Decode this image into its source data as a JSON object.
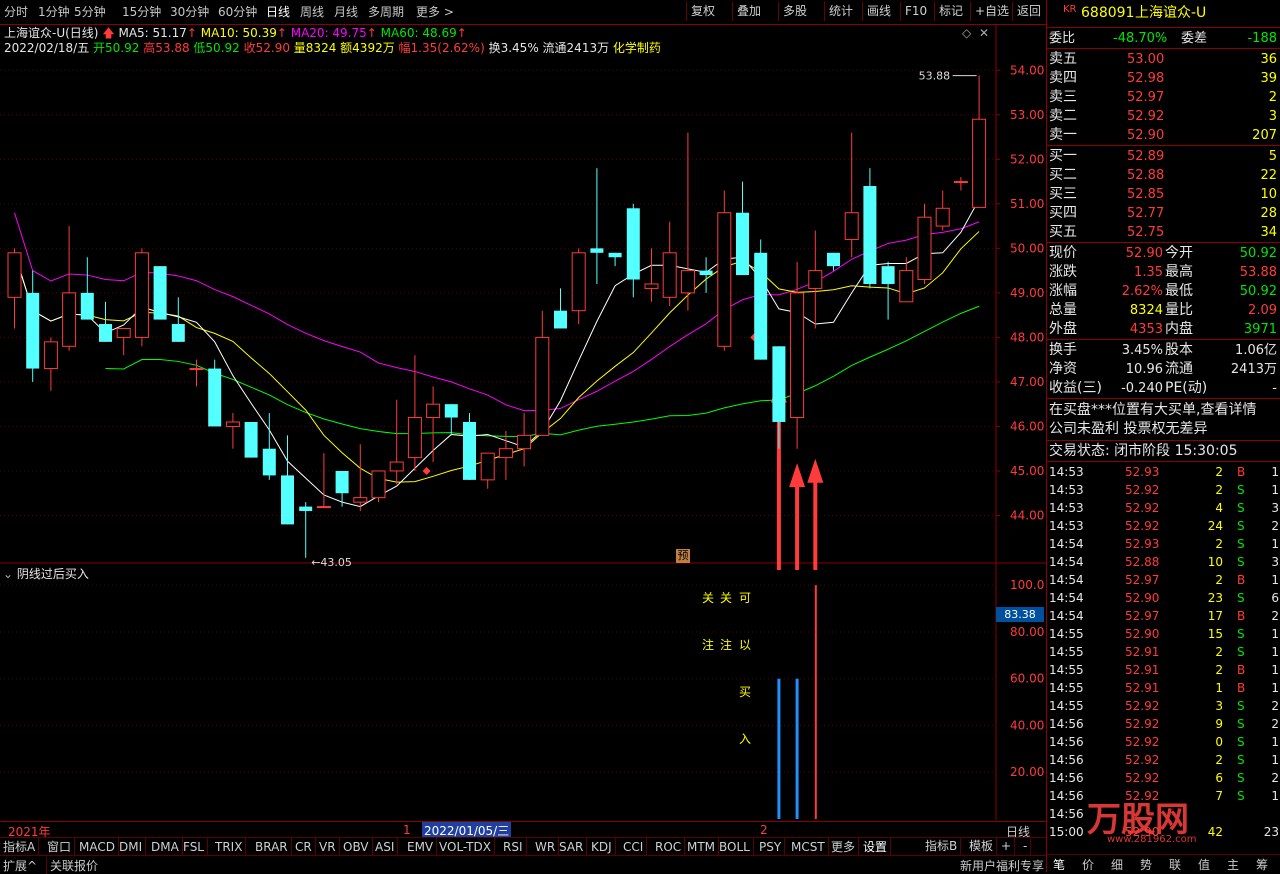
{
  "toolbar": {
    "periods": [
      "分时",
      "1分钟",
      "5分钟",
      "15分钟",
      "30分钟",
      "60分钟",
      "日线",
      "周线",
      "月线",
      "多周期",
      "更多"
    ],
    "active_period": "日线",
    "tools": [
      "复权",
      "叠加",
      "多股",
      "统计",
      "画线",
      "F10",
      "标记",
      "+自选",
      "返回"
    ]
  },
  "stock": {
    "title_line": "上海谊众-U(日线)",
    "ma5": "MA5: 51.17",
    "ma10": "MA10: 50.39",
    "ma20": "MA20: 49.75",
    "ma60": "MA60: 48.69",
    "date": "2022/02/18/五",
    "open": "开50.92",
    "high": "高53.88",
    "low": "低50.92",
    "close": "收52.90",
    "volume": "量8324",
    "amount": "额4392万",
    "change": "幅1.35(2.62%)",
    "turnover": "换3.45%",
    "float": "流通2413万",
    "sector": "化学制药"
  },
  "chart_data": {
    "type": "candlestick",
    "title": "上海谊众-U(日线)",
    "ylim": [
      43.0,
      54.5
    ],
    "yticks": [
      "54.00",
      "53.00",
      "52.00",
      "51.00",
      "50.00",
      "49.00",
      "48.00",
      "47.00",
      "46.00",
      "45.00",
      "44.00"
    ],
    "annotations": [
      "53.88",
      "43.05"
    ],
    "candles": [
      {
        "o": 48.9,
        "h": 50.0,
        "l": 48.2,
        "c": 49.9
      },
      {
        "o": 49.0,
        "h": 49.5,
        "l": 47.0,
        "c": 47.3
      },
      {
        "o": 47.3,
        "h": 48.0,
        "l": 46.8,
        "c": 47.9
      },
      {
        "o": 47.8,
        "h": 50.5,
        "l": 47.7,
        "c": 49.0
      },
      {
        "o": 49.0,
        "h": 49.8,
        "l": 48.4,
        "c": 48.4
      },
      {
        "o": 48.3,
        "h": 48.8,
        "l": 47.9,
        "c": 47.9
      },
      {
        "o": 48.0,
        "h": 48.2,
        "l": 47.6,
        "c": 48.2
      },
      {
        "o": 48.0,
        "h": 50.0,
        "l": 47.8,
        "c": 49.9
      },
      {
        "o": 49.6,
        "h": 49.6,
        "l": 48.4,
        "c": 48.4
      },
      {
        "o": 48.3,
        "h": 48.9,
        "l": 47.9,
        "c": 47.9
      },
      {
        "o": 47.3,
        "h": 47.5,
        "l": 46.9,
        "c": 47.3
      },
      {
        "o": 47.3,
        "h": 47.5,
        "l": 46.0,
        "c": 46.0
      },
      {
        "o": 46.0,
        "h": 46.3,
        "l": 45.5,
        "c": 46.1
      },
      {
        "o": 46.1,
        "h": 46.1,
        "l": 45.3,
        "c": 45.3
      },
      {
        "o": 45.5,
        "h": 46.3,
        "l": 44.8,
        "c": 44.9
      },
      {
        "o": 44.9,
        "h": 45.8,
        "l": 43.8,
        "c": 43.8
      },
      {
        "o": 44.2,
        "h": 44.3,
        "l": 43.05,
        "c": 44.1
      },
      {
        "o": 44.2,
        "h": 45.4,
        "l": 44.2,
        "c": 44.2
      },
      {
        "o": 45.0,
        "h": 45.0,
        "l": 44.2,
        "c": 44.5
      },
      {
        "o": 44.3,
        "h": 45.6,
        "l": 44.1,
        "c": 44.4
      },
      {
        "o": 44.4,
        "h": 45.0,
        "l": 44.3,
        "c": 45.0
      },
      {
        "o": 45.0,
        "h": 46.6,
        "l": 44.7,
        "c": 45.2
      },
      {
        "o": 45.3,
        "h": 47.6,
        "l": 45.0,
        "c": 46.2
      },
      {
        "o": 46.2,
        "h": 46.9,
        "l": 45.2,
        "c": 46.5
      },
      {
        "o": 46.5,
        "h": 46.5,
        "l": 45.8,
        "c": 46.2
      },
      {
        "o": 46.1,
        "h": 46.3,
        "l": 44.8,
        "c": 44.8
      },
      {
        "o": 44.8,
        "h": 45.4,
        "l": 44.6,
        "c": 45.4
      },
      {
        "o": 45.3,
        "h": 45.9,
        "l": 44.8,
        "c": 45.5
      },
      {
        "o": 45.5,
        "h": 46.3,
        "l": 45.1,
        "c": 45.8
      },
      {
        "o": 45.8,
        "h": 48.6,
        "l": 45.8,
        "c": 48.0
      },
      {
        "o": 48.6,
        "h": 49.1,
        "l": 48.2,
        "c": 48.2
      },
      {
        "o": 48.6,
        "h": 50.0,
        "l": 48.3,
        "c": 49.9
      },
      {
        "o": 50.0,
        "h": 51.8,
        "l": 49.2,
        "c": 49.9
      },
      {
        "o": 49.9,
        "h": 49.9,
        "l": 49.6,
        "c": 49.8
      },
      {
        "o": 50.9,
        "h": 51.0,
        "l": 48.9,
        "c": 49.3
      },
      {
        "o": 49.1,
        "h": 50.0,
        "l": 48.8,
        "c": 49.2
      },
      {
        "o": 48.9,
        "h": 50.6,
        "l": 48.7,
        "c": 49.9
      },
      {
        "o": 49.0,
        "h": 52.6,
        "l": 48.6,
        "c": 49.5
      },
      {
        "o": 49.5,
        "h": 49.8,
        "l": 49.0,
        "c": 49.4
      },
      {
        "o": 47.8,
        "h": 51.3,
        "l": 47.7,
        "c": 50.8
      },
      {
        "o": 50.8,
        "h": 51.5,
        "l": 49.4,
        "c": 49.4
      },
      {
        "o": 49.9,
        "h": 50.2,
        "l": 47.5,
        "c": 47.5
      },
      {
        "o": 47.8,
        "h": 47.8,
        "l": 45.5,
        "c": 46.1
      },
      {
        "o": 46.2,
        "h": 49.7,
        "l": 45.5,
        "c": 49.0
      },
      {
        "o": 49.1,
        "h": 50.4,
        "l": 48.2,
        "c": 49.5
      },
      {
        "o": 49.9,
        "h": 49.9,
        "l": 49.5,
        "c": 49.6
      },
      {
        "o": 50.2,
        "h": 52.6,
        "l": 49.8,
        "c": 50.8
      },
      {
        "o": 51.4,
        "h": 51.8,
        "l": 49.1,
        "c": 49.2
      },
      {
        "o": 49.6,
        "h": 49.7,
        "l": 48.4,
        "c": 49.2
      },
      {
        "o": 48.8,
        "h": 49.8,
        "l": 48.8,
        "c": 49.5
      },
      {
        "o": 49.3,
        "h": 51.0,
        "l": 49.2,
        "c": 50.7
      },
      {
        "o": 50.5,
        "h": 51.3,
        "l": 50.4,
        "c": 50.9
      },
      {
        "o": 51.5,
        "h": 51.6,
        "l": 51.3,
        "c": 51.5
      },
      {
        "o": 50.92,
        "h": 53.88,
        "l": 50.92,
        "c": 52.9
      }
    ],
    "ma_colors": {
      "ma5": "#ffffff",
      "ma10": "#ffff00",
      "ma20": "#ff00ff",
      "ma60": "#00ff00"
    },
    "indicator": {
      "name": "阴线过后买入",
      "yticks": [
        "100.0",
        "80.00",
        "60.00",
        "40.00",
        "20.00"
      ],
      "current": "83.38",
      "labels_top": [
        "关",
        "关",
        "可"
      ],
      "labels_mid": [
        "注",
        "注",
        "以"
      ],
      "labels_buy": [
        "买",
        "入"
      ]
    },
    "x_labels": [
      "2021年",
      "1",
      "2022/01/05/三",
      "2"
    ],
    "badge": "预"
  },
  "panel": {
    "code": "688091",
    "name": "上海谊众-U",
    "kr": "KR",
    "weibi_label": "委比",
    "weibi": "-48.70%",
    "weicha_label": "委差",
    "weicha": "-188",
    "asks": [
      {
        "label": "卖五",
        "price": "53.00",
        "vol": "36"
      },
      {
        "label": "卖四",
        "price": "52.98",
        "vol": "39"
      },
      {
        "label": "卖三",
        "price": "52.97",
        "vol": "2"
      },
      {
        "label": "卖二",
        "price": "52.92",
        "vol": "3"
      },
      {
        "label": "卖一",
        "price": "52.90",
        "vol": "207"
      }
    ],
    "bids": [
      {
        "label": "买一",
        "price": "52.89",
        "vol": "5"
      },
      {
        "label": "买二",
        "price": "52.88",
        "vol": "22"
      },
      {
        "label": "买三",
        "price": "52.85",
        "vol": "10"
      },
      {
        "label": "买四",
        "price": "52.77",
        "vol": "28"
      },
      {
        "label": "买五",
        "price": "52.75",
        "vol": "34"
      }
    ],
    "stats": [
      {
        "l1": "现价",
        "v1": "52.90",
        "l2": "今开",
        "v2": "50.92",
        "c1": "red",
        "c2": "green"
      },
      {
        "l1": "涨跌",
        "v1": "1.35",
        "l2": "最高",
        "v2": "53.88",
        "c1": "red",
        "c2": "red"
      },
      {
        "l1": "涨幅",
        "v1": "2.62%",
        "l2": "最低",
        "v2": "50.92",
        "c1": "red",
        "c2": "green"
      },
      {
        "l1": "总量",
        "v1": "8324",
        "l2": "量比",
        "v2": "2.09",
        "c1": "yel",
        "c2": "red"
      },
      {
        "l1": "外盘",
        "v1": "4353",
        "l2": "内盘",
        "v2": "3971",
        "c1": "red",
        "c2": "green"
      }
    ],
    "fund": [
      {
        "l1": "换手",
        "v1": "3.45%",
        "l2": "股本",
        "v2": "1.06亿"
      },
      {
        "l1": "净资",
        "v1": "10.96",
        "l2": "流通",
        "v2": "2413万"
      },
      {
        "l1": "收益(三)",
        "v1": "-0.240",
        "l2": "PE(动)",
        "v2": "-"
      }
    ],
    "notice1": "在买盘***位置有大买单,查看详情",
    "notice2": "公司未盈利 投票权无差异",
    "status": "交易状态: 闭市阶段 15:30:05",
    "ticks": [
      {
        "t": "14:53",
        "p": "52.93",
        "v": "2",
        "s": "B",
        "n": "1"
      },
      {
        "t": "14:53",
        "p": "52.92",
        "v": "2",
        "s": "S",
        "n": "1"
      },
      {
        "t": "14:53",
        "p": "52.92",
        "v": "4",
        "s": "S",
        "n": "3"
      },
      {
        "t": "14:53",
        "p": "52.92",
        "v": "24",
        "s": "S",
        "n": "2"
      },
      {
        "t": "14:54",
        "p": "52.93",
        "v": "2",
        "s": "S",
        "n": "1"
      },
      {
        "t": "14:54",
        "p": "52.88",
        "v": "10",
        "s": "S",
        "n": "3"
      },
      {
        "t": "14:54",
        "p": "52.97",
        "v": "2",
        "s": "B",
        "n": "1"
      },
      {
        "t": "14:54",
        "p": "52.90",
        "v": "23",
        "s": "S",
        "n": "6"
      },
      {
        "t": "14:54",
        "p": "52.97",
        "v": "17",
        "s": "B",
        "n": "2"
      },
      {
        "t": "14:55",
        "p": "52.90",
        "v": "15",
        "s": "S",
        "n": "1"
      },
      {
        "t": "14:55",
        "p": "52.91",
        "v": "2",
        "s": "S",
        "n": "1"
      },
      {
        "t": "14:55",
        "p": "52.91",
        "v": "2",
        "s": "B",
        "n": "1"
      },
      {
        "t": "14:55",
        "p": "52.91",
        "v": "1",
        "s": "B",
        "n": "1"
      },
      {
        "t": "14:55",
        "p": "52.92",
        "v": "3",
        "s": "S",
        "n": "2"
      },
      {
        "t": "14:56",
        "p": "52.92",
        "v": "9",
        "s": "S",
        "n": "2"
      },
      {
        "t": "14:56",
        "p": "52.92",
        "v": "0",
        "s": "S",
        "n": "1"
      },
      {
        "t": "14:56",
        "p": "52.92",
        "v": "2",
        "s": "S",
        "n": "1"
      },
      {
        "t": "14:56",
        "p": "52.92",
        "v": "6",
        "s": "S",
        "n": "2"
      },
      {
        "t": "14:56",
        "p": "52.92",
        "v": "7",
        "s": "S",
        "n": "1"
      },
      {
        "t": "14:56",
        "p": "",
        "v": "",
        "s": "",
        "n": ""
      },
      {
        "t": "15:00",
        "p": "52.90",
        "v": "42",
        "s": "",
        "n": "23"
      }
    ],
    "bottom_tabs": [
      "笔",
      "价",
      "细",
      "势",
      "联",
      "值",
      "主",
      "筹"
    ]
  },
  "bottom": {
    "tabs": [
      "指标A",
      "窗口",
      "MACD",
      "DMI",
      "DMA",
      "FSL",
      "TRIX",
      "BRAR",
      "CR",
      "VR",
      "OBV",
      "ASI",
      "EMV",
      "VOL-TDX",
      "RSI",
      "WR",
      "SAR",
      "KDJ",
      "CCI",
      "ROC",
      "MTM",
      "BOLL",
      "PSY",
      "MCST",
      "更多",
      "设置"
    ],
    "right_tabs": [
      "指标B",
      "模板",
      "+",
      "-"
    ],
    "period_label": "日线",
    "ext": "扩展^",
    "linked": "关联报价",
    "promo": "新用户福利专享"
  },
  "watermark": "万股网 www.281962.com"
}
